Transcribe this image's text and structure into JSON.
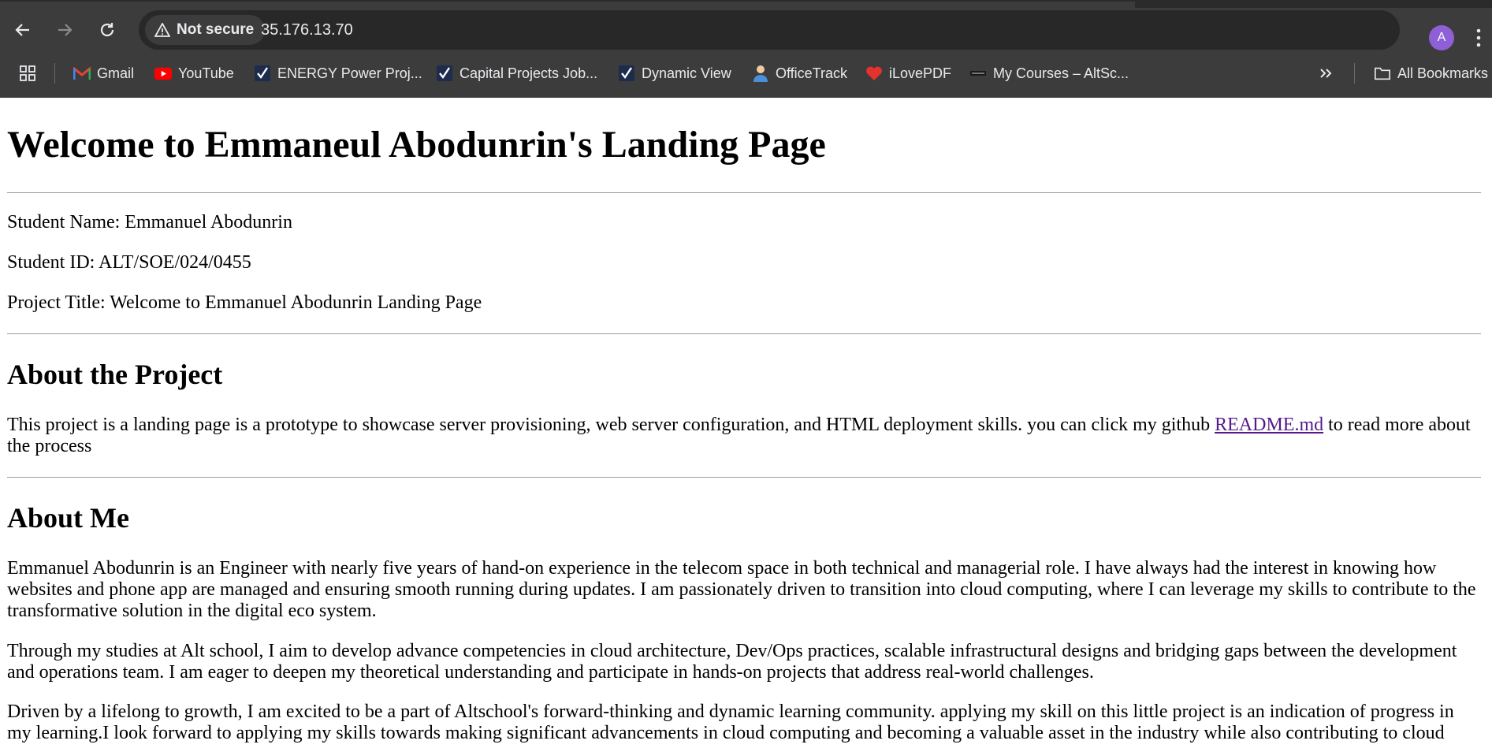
{
  "browser": {
    "security_label": "Not secure",
    "url": "35.176.13.70",
    "profile_initial": "A",
    "bookmarks": [
      {
        "label": "Gmail",
        "icon": "gmail-icon"
      },
      {
        "label": "YouTube",
        "icon": "youtube-icon"
      },
      {
        "label": "ENERGY Power Proj...",
        "icon": "checkmark-icon"
      },
      {
        "label": "Capital Projects Job...",
        "icon": "checkmark-icon"
      },
      {
        "label": "Dynamic View",
        "icon": "checkmark-icon"
      },
      {
        "label": "OfficeTrack",
        "icon": "officetrack-icon"
      },
      {
        "label": "iLovePDF",
        "icon": "heart-icon"
      },
      {
        "label": "My Courses – AltSc...",
        "icon": "altschool-icon"
      }
    ],
    "all_bookmarks_label": "All Bookmarks",
    "colors": {
      "chrome": "#3c3c3c",
      "omnibox": "#282828",
      "avatar": "#8e5fd6"
    }
  },
  "page": {
    "title": "Welcome to Emmaneul Abodunrin's Landing Page",
    "student_name": "Student Name: Emmanuel Abodunrin",
    "student_id": "Student ID: ALT/SOE/024/0455",
    "project_title": "Project Title: Welcome to Emmanuel Abodunrin Landing Page",
    "about_project": {
      "heading": "About the Project",
      "text_before_link": "This project is a landing page is a prototype to showcase server provisioning, web server configuration, and HTML deployment skills. you can click my github ",
      "link_text": "README.md",
      "text_after_link": " to read more about the process"
    },
    "about_me": {
      "heading": "About Me",
      "paragraphs": [
        "Emmanuel Abodunrin is an Engineer with nearly five years of hand-on experience in the telecom space in both technical and managerial role. I have always had the interest in knowing how websites and phone app are managed and ensuring smooth running during updates. I am passionately driven to transition into cloud computing, where I can leverage my skills to contribute to the transformative solution in the digital eco system.",
        "Through my studies at Alt school, I aim to develop advance competencies in cloud architecture, Dev/Ops practices, scalable infrastructural designs and bridging gaps between the development and operations team. I am eager to deepen my theoretical understanding and participate in hands-on projects that address real-world challenges.",
        "Driven by a lifelong to growth, I am excited to be a part of Altschool's forward-thinking and dynamic learning community. applying my skill on this little project is an indication of progress in my learning.I look forward to applying my skills towards making significant advancements in cloud computing and becoming a valuable asset in the industry while also contributing to cloud"
      ]
    },
    "link_color": "#551a8b"
  }
}
